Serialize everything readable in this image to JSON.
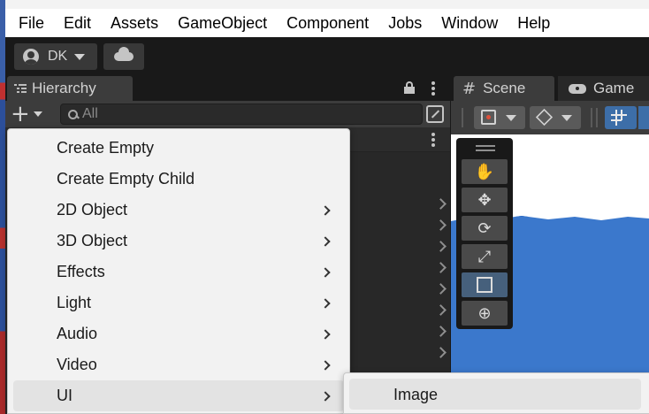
{
  "menubar": {
    "items": [
      "File",
      "Edit",
      "Assets",
      "GameObject",
      "Component",
      "Jobs",
      "Window",
      "Help"
    ]
  },
  "toolbar": {
    "account_label": "DK"
  },
  "hierarchy": {
    "tab_label": "Hierarchy",
    "search_placeholder": "All"
  },
  "scene_panel": {
    "tabs": [
      "Scene",
      "Game"
    ]
  },
  "context_menu": {
    "items": [
      {
        "label": "Create Empty",
        "submenu": false
      },
      {
        "label": "Create Empty Child",
        "submenu": false
      },
      {
        "label": "2D Object",
        "submenu": true
      },
      {
        "label": "3D Object",
        "submenu": true
      },
      {
        "label": "Effects",
        "submenu": true
      },
      {
        "label": "Light",
        "submenu": true
      },
      {
        "label": "Audio",
        "submenu": true
      },
      {
        "label": "Video",
        "submenu": true
      },
      {
        "label": "UI",
        "submenu": true,
        "highlighted": true
      }
    ],
    "submenu_items": [
      "Image"
    ]
  },
  "colors": {
    "accent": "#3d6ea8",
    "menu_bg": "#f2f2f2",
    "menu_highlight": "#e3e3e3",
    "panel_bg": "#282828"
  }
}
